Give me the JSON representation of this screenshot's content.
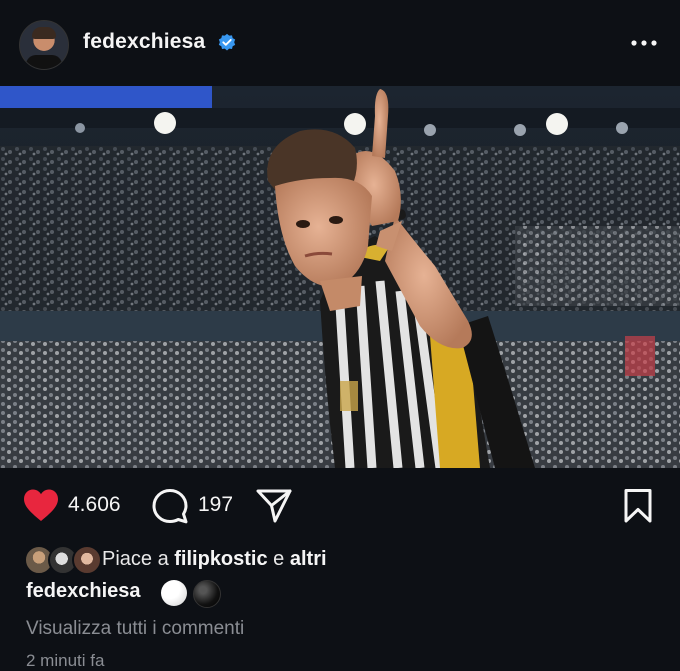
{
  "post": {
    "username": "fedexchiesa",
    "verified": true,
    "likes": "4.606",
    "comments": "197",
    "liked_by_prefix": "Piace a ",
    "liked_by_user": "filipkostic",
    "liked_by_and": " e ",
    "liked_by_others": "altri",
    "caption_user": "fedexchiesa",
    "view_comments": "Visualizza tutti i commenti",
    "time_ago": "2 minuti fa"
  },
  "icons": {
    "verified": "verified-badge-icon",
    "more": "more-options-icon",
    "like": "heart-icon",
    "comment": "comment-bubble-icon",
    "share": "paper-plane-icon",
    "save": "bookmark-icon"
  },
  "colors": {
    "background": "#0d1015",
    "like": "#e8263e",
    "verified": "#3897f0",
    "muted": "#8a8d93"
  }
}
